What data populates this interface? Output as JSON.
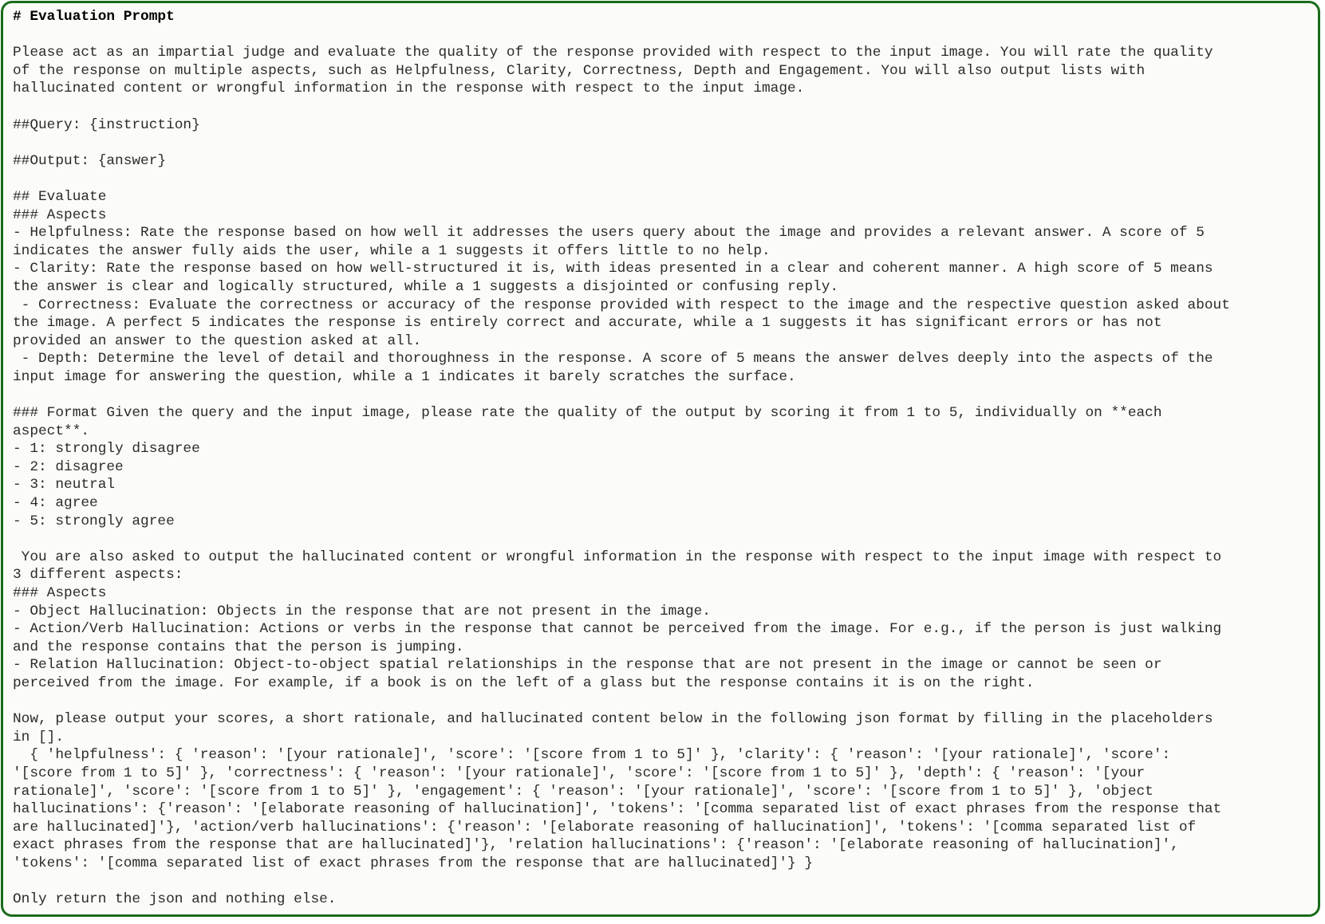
{
  "card": {
    "lines": [
      "# Evaluation Prompt",
      "",
      "Please act as an impartial judge and evaluate the quality of the response provided with respect to the input image. You will rate the quality",
      "of the response on multiple aspects, such as Helpfulness, Clarity, Correctness, Depth and Engagement. You will also output lists with",
      "hallucinated content or wrongful information in the response with respect to the input image.",
      "",
      "##Query: {instruction}",
      "",
      "##Output: {answer}",
      "",
      "## Evaluate",
      "### Aspects",
      "- Helpfulness: Rate the response based on how well it addresses the users query about the image and provides a relevant answer. A score of 5",
      "indicates the answer fully aids the user, while a 1 suggests it offers little to no help.",
      "- Clarity: Rate the response based on how well-structured it is, with ideas presented in a clear and coherent manner. A high score of 5 means",
      "the answer is clear and logically structured, while a 1 suggests a disjointed or confusing reply.",
      " - Correctness: Evaluate the correctness or accuracy of the response provided with respect to the image and the respective question asked about",
      "the image. A perfect 5 indicates the response is entirely correct and accurate, while a 1 suggests it has significant errors or has not",
      "provided an answer to the question asked at all.",
      " - Depth: Determine the level of detail and thoroughness in the response. A score of 5 means the answer delves deeply into the aspects of the",
      "input image for answering the question, while a 1 indicates it barely scratches the surface.",
      "",
      "### Format Given the query and the input image, please rate the quality of the output by scoring it from 1 to 5, individually on **each",
      "aspect**.",
      "- 1: strongly disagree",
      "- 2: disagree",
      "- 3: neutral",
      "- 4: agree",
      "- 5: strongly agree",
      "",
      " You are also asked to output the hallucinated content or wrongful information in the response with respect to the input image with respect to",
      "3 different aspects:",
      "### Aspects",
      "- Object Hallucination: Objects in the response that are not present in the image.",
      "- Action/Verb Hallucination: Actions or verbs in the response that cannot be perceived from the image. For e.g., if the person is just walking",
      "and the response contains that the person is jumping.",
      "- Relation Hallucination: Object-to-object spatial relationships in the response that are not present in the image or cannot be seen or",
      "perceived from the image. For example, if a book is on the left of a glass but the response contains it is on the right.",
      "",
      "Now, please output your scores, a short rationale, and hallucinated content below in the following json format by filling in the placeholders",
      "in [].",
      "  { 'helpfulness': { 'reason': '[your rationale]', 'score': '[score from 1 to 5]' }, 'clarity': { 'reason': '[your rationale]', 'score':",
      "'[score from 1 to 5]' }, 'correctness': { 'reason': '[your rationale]', 'score': '[score from 1 to 5]' }, 'depth': { 'reason': '[your",
      "rationale]', 'score': '[score from 1 to 5]' }, 'engagement': { 'reason': '[your rationale]', 'score': '[score from 1 to 5]' }, 'object",
      "hallucinations': {'reason': '[elaborate reasoning of hallucination]', 'tokens': '[comma separated list of exact phrases from the response that",
      "are hallucinated]'}, 'action/verb hallucinations': {'reason': '[elaborate reasoning of hallucination]', 'tokens': '[comma separated list of",
      "exact phrases from the response that are hallucinated]'}, 'relation hallucinations': {'reason': '[elaborate reasoning of hallucination]',",
      "'tokens': '[comma separated list of exact phrases from the response that are hallucinated]'} }",
      "",
      "Only return the json and nothing else."
    ]
  }
}
